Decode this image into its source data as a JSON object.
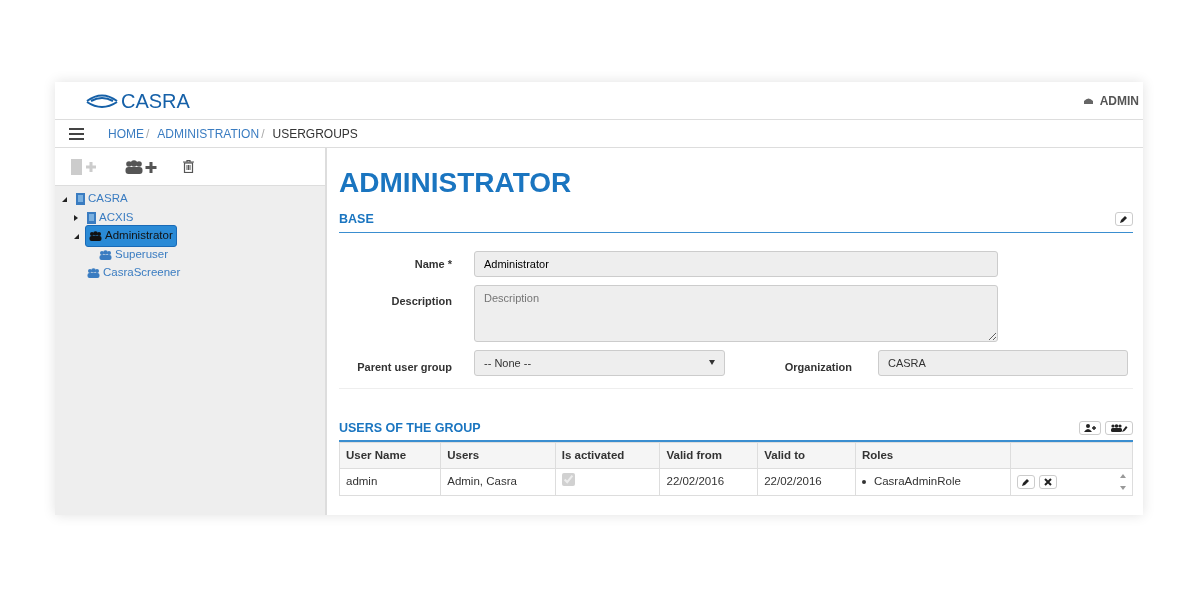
{
  "header": {
    "logo": "CASRA",
    "user": "ADMIN"
  },
  "breadcrumb": [
    {
      "label": "HOME",
      "link": true,
      "separator": "/"
    },
    {
      "label": "ADMINISTRATION",
      "link": true,
      "separator": "/"
    },
    {
      "label": "USERGROUPS",
      "link": false
    }
  ],
  "toolbar": [
    {
      "kind": "add-org",
      "disabled": true
    },
    {
      "kind": "add-group",
      "disabled": false
    },
    {
      "kind": "delete",
      "disabled": false
    }
  ],
  "tree": [
    {
      "label": "CASRA",
      "kind": "org",
      "expanded": true,
      "selected": false,
      "children": [
        {
          "label": "ACXIS",
          "kind": "org",
          "expanded": false,
          "selected": false
        },
        {
          "label": "Administrator",
          "kind": "group",
          "expanded": true,
          "selected": true,
          "children": [
            {
              "label": "Superuser",
              "kind": "group",
              "selected": false
            }
          ]
        },
        {
          "label": "CasraScreener",
          "kind": "group",
          "selected": false
        }
      ]
    }
  ],
  "title": "ADMINISTRATOR",
  "base": {
    "heading": "BASE",
    "name_label": "Name *",
    "name_value": "Administrator",
    "description_label": "Description",
    "description_placeholder": "Description",
    "parent_label": "Parent user group",
    "parent_value": "-- None --",
    "organization_label": "Organization",
    "organization_value": "CASRA"
  },
  "users": {
    "heading": "USERS OF THE GROUP",
    "columns": [
      "User Name",
      "Users",
      "Is activated",
      "Valid from",
      "Valid to",
      "Roles"
    ],
    "rows": [
      {
        "user_name": "admin",
        "users": "Admin, Casra",
        "activated": true,
        "valid_from": "22/02/2016",
        "valid_to": "22/02/2016",
        "roles": [
          "CasraAdminRole"
        ]
      }
    ]
  }
}
